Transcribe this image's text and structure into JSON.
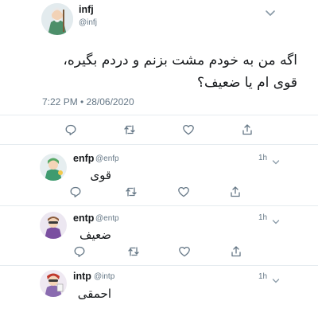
{
  "main_tweet": {
    "name": "infj",
    "handle": "@infj",
    "text_line1": "اگه من به خودم مشت بزنم و دردم بگیره،",
    "text_line2": "قوی ام یا ضعیف؟",
    "timestamp": "7:22 PM • 28/06/2020"
  },
  "replies": [
    {
      "name": "enfp",
      "handle": "@enfp",
      "time": "1h",
      "text": "قوی"
    },
    {
      "name": "entp",
      "handle": "@entp",
      "time": "1h",
      "text": "ضعیف"
    },
    {
      "name": "intp",
      "handle": "@intp",
      "time": "1h",
      "text": "احمقی"
    }
  ],
  "icons": {
    "reply": "reply-icon",
    "retweet": "retweet-icon",
    "like": "heart-icon",
    "share": "share-icon",
    "menu": "chevron-down-icon"
  },
  "colors": {
    "text": "#14171a",
    "muted": "#657786",
    "divider": "#e6ecf0",
    "icon": "#657786"
  }
}
